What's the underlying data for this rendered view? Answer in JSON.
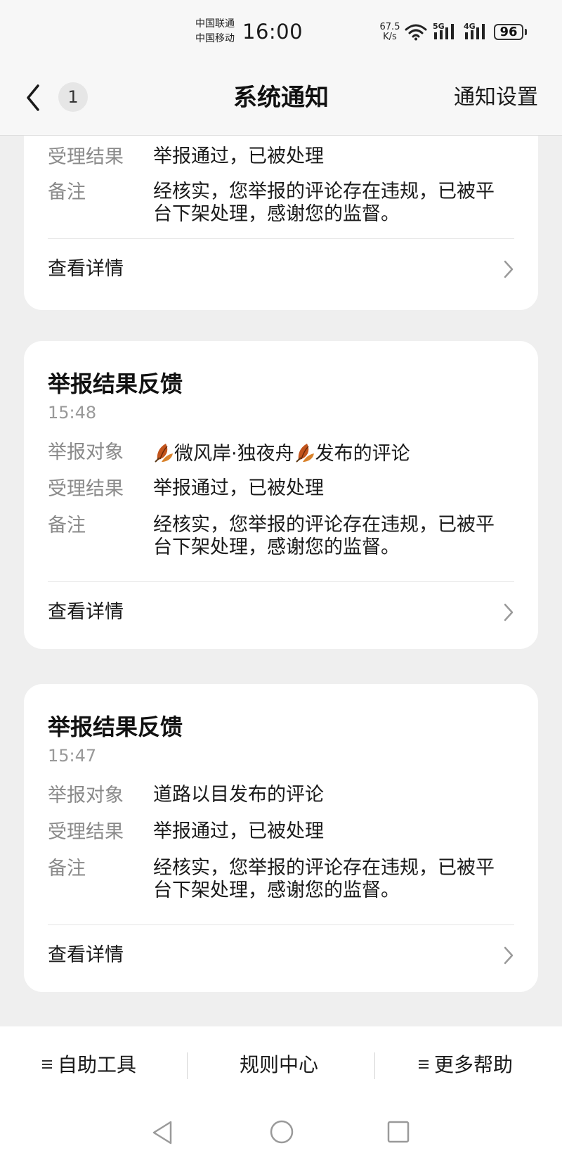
{
  "status_bar": {
    "carrier_1": "中国联通",
    "carrier_2": "中国移动",
    "time": "16:00",
    "net_speed_value": "67.5",
    "net_speed_unit": "K/s",
    "signal_1_tag": "5G",
    "signal_2_tag": "4G",
    "battery": "96"
  },
  "header": {
    "unread_count": "1",
    "title": "系统通知",
    "settings_label": "通知设置"
  },
  "cards": [
    {
      "rows": [
        {
          "label": "受理结果",
          "value": "举报通过，已被处理"
        },
        {
          "label": "备注",
          "value": "经核实，您举报的评论存在违规，已被平台下架处理，感谢您的监督。"
        }
      ],
      "detail_label": "查看详情"
    },
    {
      "title": "举报结果反馈",
      "time": "15:48",
      "target_label": "举报对象",
      "target_name": "微风岸·独夜舟",
      "target_suffix": "发布的评论",
      "rows": [
        {
          "label": "受理结果",
          "value": "举报通过，已被处理"
        },
        {
          "label": "备注",
          "value": "经核实，您举报的评论存在违规，已被平台下架处理，感谢您的监督。"
        }
      ],
      "detail_label": "查看详情"
    },
    {
      "title": "举报结果反馈",
      "time": "15:47",
      "rows": [
        {
          "label": "举报对象",
          "value": "道路以目发布的评论"
        },
        {
          "label": "受理结果",
          "value": "举报通过，已被处理"
        },
        {
          "label": "备注",
          "value": "经核实，您举报的评论存在违规，已被平台下架处理，感谢您的监督。"
        }
      ],
      "detail_label": "查看详情"
    }
  ],
  "toolbar": {
    "self_help": "自助工具",
    "rules_center": "规则中心",
    "more_help": "更多帮助"
  },
  "colors": {
    "background": "#efefef",
    "card": "#ffffff",
    "label_gray": "#8a8a8a",
    "text": "#1a1a1a"
  }
}
